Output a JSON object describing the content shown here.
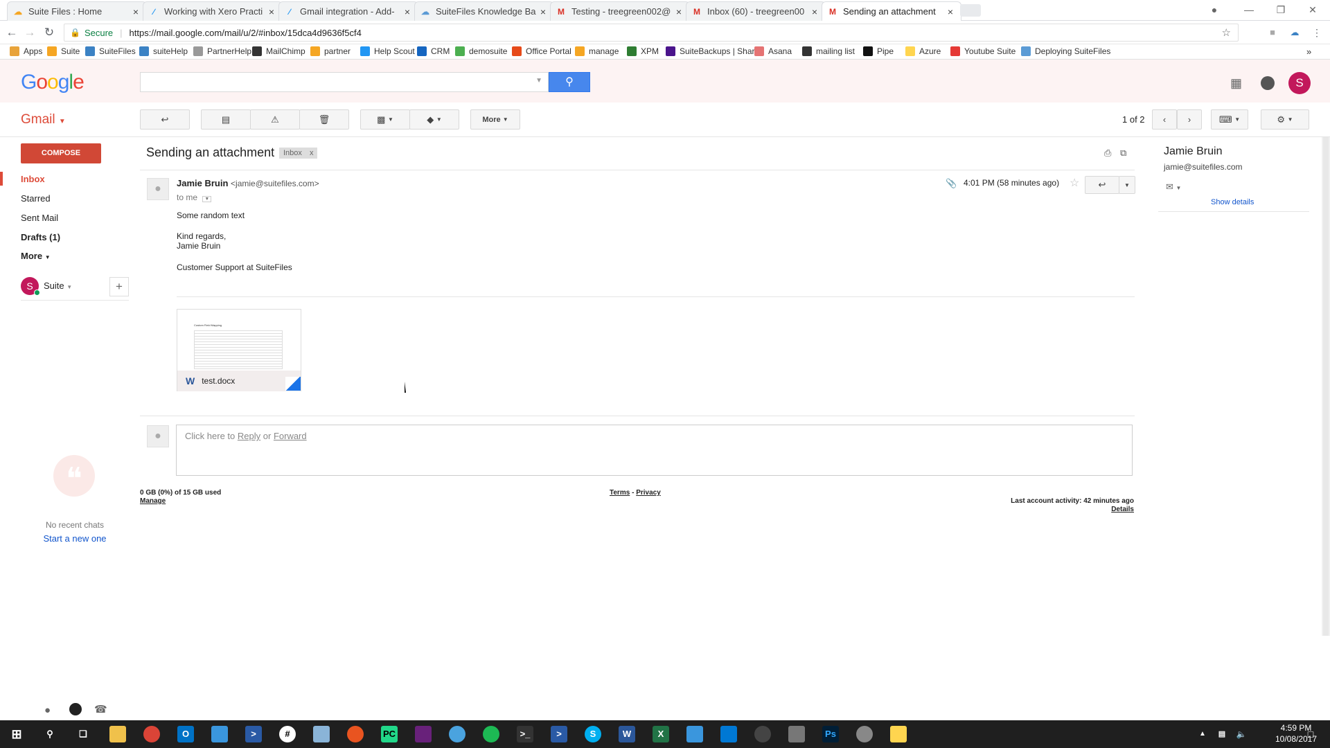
{
  "tabs": [
    {
      "title": "Suite Files : Home",
      "icon": "suitefiles-cloud-icon",
      "color": "#f5a623"
    },
    {
      "title": "Working with Xero Practi",
      "icon": "feather-icon",
      "color": "#2196f3"
    },
    {
      "title": "Gmail integration - Add-",
      "icon": "feather-icon",
      "color": "#2196f3"
    },
    {
      "title": "SuiteFiles Knowledge Ba",
      "icon": "suitefiles-cloud-icon",
      "color": "#5b9bd5"
    },
    {
      "title": "Testing - treegreen002@",
      "icon": "gmail-icon",
      "color": "#d93025"
    },
    {
      "title": "Inbox (60) - treegreen00",
      "icon": "gmail-icon",
      "color": "#d93025"
    },
    {
      "title": "Sending an attachment",
      "icon": "gmail-icon",
      "color": "#d93025"
    }
  ],
  "address_bar": {
    "secure_label": "Secure",
    "url": "https://mail.google.com/mail/u/2/#inbox/15dca4d9636f5cf4"
  },
  "bookmarks": [
    {
      "label": "Apps",
      "color": "#e8a33a"
    },
    {
      "label": "Suite",
      "color": "#f5a623"
    },
    {
      "label": "SuiteFiles",
      "color": "#3b82c4"
    },
    {
      "label": "suiteHelp",
      "color": "#3b82c4"
    },
    {
      "label": "PartnerHelp",
      "color": "#999999"
    },
    {
      "label": "MailChimp",
      "color": "#333333"
    },
    {
      "label": "partner",
      "color": "#f5a623"
    },
    {
      "label": "Help Scout",
      "color": "#2196f3"
    },
    {
      "label": "CRM",
      "color": "#1565c0"
    },
    {
      "label": "demosuite",
      "color": "#4caf50"
    },
    {
      "label": "Office Portal",
      "color": "#e64a19"
    },
    {
      "label": "manage",
      "color": "#f5a623"
    },
    {
      "label": "XPM",
      "color": "#2e7d32"
    },
    {
      "label": "SuiteBackups | Share",
      "color": "#4a148c"
    },
    {
      "label": "Asana",
      "color": "#e57373"
    },
    {
      "label": "mailing list",
      "color": "#333333"
    },
    {
      "label": "Pipe",
      "color": "#111111"
    },
    {
      "label": "Azure",
      "color": "#ffd54f"
    },
    {
      "label": "Youtube Suite",
      "color": "#e53935"
    },
    {
      "label": "Deploying SuiteFiles",
      "color": "#5b9bd5"
    }
  ],
  "header": {
    "logo_text": "Google",
    "app_label": "Gmail",
    "avatar_letter": "S"
  },
  "toolbar": {
    "more_label": "More",
    "pager": "1 of 2"
  },
  "nav": {
    "compose_label": "COMPOSE",
    "items": [
      "Inbox",
      "Starred",
      "Sent Mail",
      "Drafts (1)",
      "More"
    ],
    "account_label": "Suite",
    "account_letter": "S"
  },
  "message": {
    "subject": "Sending an attachment",
    "label_tag": "Inbox",
    "sender_name": "Jamie Bruin",
    "sender_email": "<jamie@suitefiles.com>",
    "recipient": "to me",
    "time": "4:01 PM (58 minutes ago)",
    "body_line1": "Some random text",
    "body_line2": "Kind regards,",
    "body_line3": "Jamie Bruin",
    "body_line4": "Customer Support at SuiteFiles",
    "attachment_name": "test.docx",
    "attachment_preview_title": "Custom Field Mapping"
  },
  "reply": {
    "prefix": "Click here to",
    "reply_link": "Reply",
    "or": "or",
    "forward_link": "Forward"
  },
  "footer": {
    "storage": "0 GB (0%) of 15 GB used",
    "manage": "Manage",
    "terms": "Terms",
    "dash": "-",
    "privacy": "Privacy",
    "last_activity": "Last account activity: 42 minutes ago",
    "details": "Details"
  },
  "contact": {
    "name": "Jamie Bruin",
    "email": "jamie@suitefiles.com",
    "show_details": "Show details"
  },
  "chat": {
    "no_recent": "No recent chats",
    "start_new": "Start a new one"
  },
  "taskbar": {
    "time": "4:59 PM",
    "date": "10/08/2017"
  }
}
